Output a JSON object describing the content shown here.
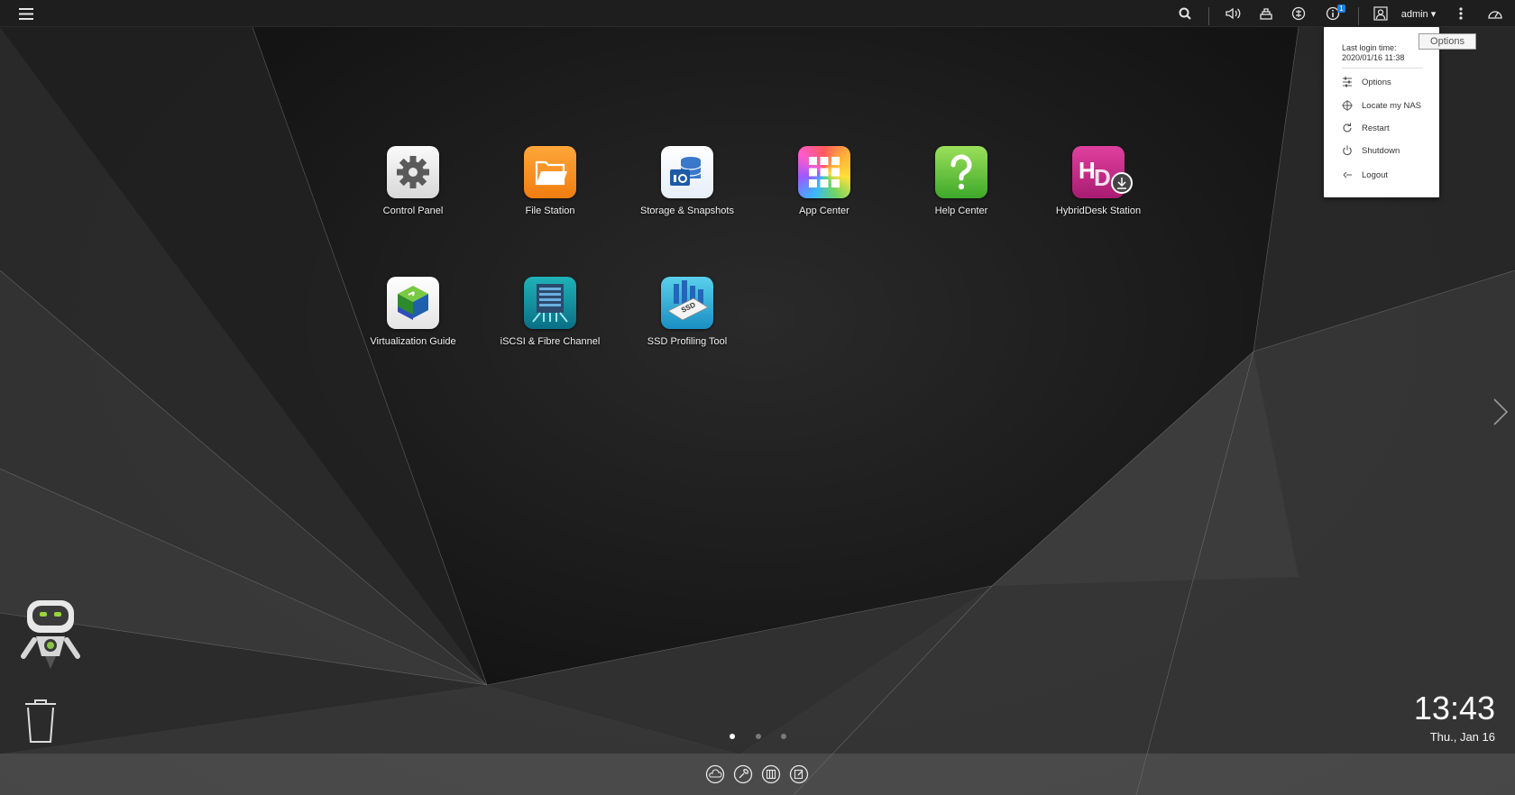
{
  "topbar": {
    "menu_icon": "hamburger-icon",
    "icons": [
      "search-icon",
      "volume-icon",
      "background-task-icon",
      "external-device-icon",
      "event-notification-icon",
      "user-icon",
      "more-options-icon",
      "dashboard-icon"
    ],
    "notification_count": "1",
    "user_label": "admin ▾"
  },
  "tooltip": {
    "text": "Options"
  },
  "user_menu": {
    "login_label": "Last login time:",
    "login_time": "2020/01/16 11:38",
    "items": [
      {
        "label": "Options",
        "icon": "sliders-icon"
      },
      {
        "label": "Locate my NAS",
        "icon": "locate-icon"
      },
      {
        "label": "Restart",
        "icon": "restart-icon"
      },
      {
        "label": "Shutdown",
        "icon": "power-icon"
      },
      {
        "label": "Logout",
        "icon": "logout-icon"
      }
    ]
  },
  "apps": [
    {
      "label": "Control Panel",
      "icon": "gear-icon"
    },
    {
      "label": "File Station",
      "icon": "folder-icon"
    },
    {
      "label": "Storage & Snapshots",
      "icon": "storage-icon"
    },
    {
      "label": "App Center",
      "icon": "grid-icon"
    },
    {
      "label": "Help Center",
      "icon": "question-icon"
    },
    {
      "label": "HybridDesk Station",
      "icon": "hd-icon"
    },
    {
      "label": "Virtualization Guide",
      "icon": "cube-icon"
    },
    {
      "label": "iSCSI & Fibre Channel",
      "icon": "server-icon"
    },
    {
      "label": "SSD Profiling Tool",
      "icon": "ssd-icon"
    }
  ],
  "pagination": {
    "pages": 3,
    "current": 1
  },
  "dock": {
    "icons": [
      "cloud-icon",
      "tools-icon",
      "book-icon",
      "note-icon"
    ]
  },
  "clock": {
    "time": "13:43",
    "date": "Thu., Jan 16"
  },
  "colors": {
    "accent": "#1e7fe0",
    "file_station": "#f7941d",
    "help_center": "#6fc13d",
    "hybriddesk": "#c2278a"
  }
}
